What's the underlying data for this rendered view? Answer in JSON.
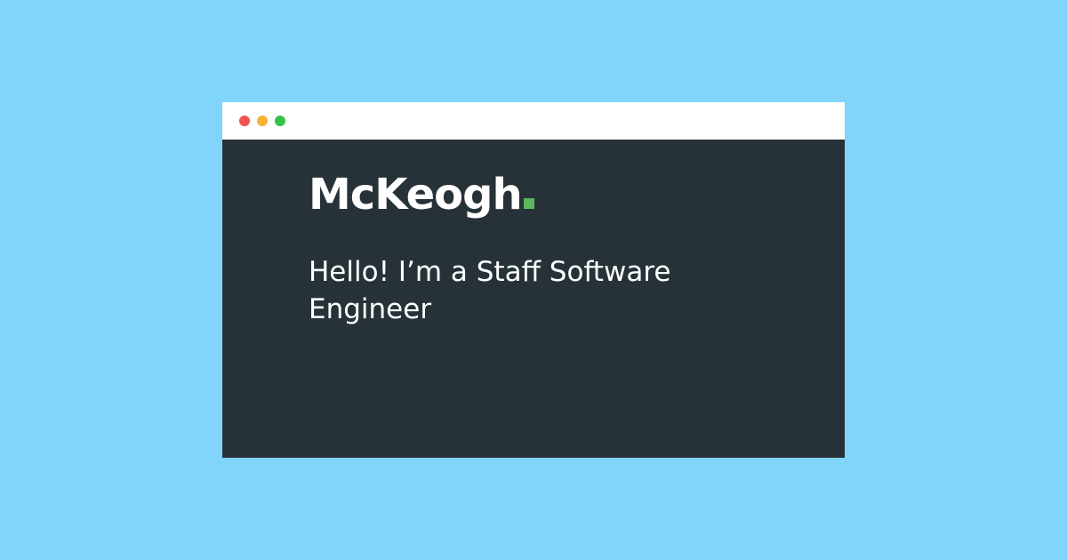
{
  "colors": {
    "background": "#81d4fa",
    "titlebar": "#ffffff",
    "content": "#263238",
    "text": "#ffffff",
    "brand_accent": "#5cb85c",
    "dot_close": "#ef5350",
    "dot_minimize": "#f9b233",
    "dot_maximize": "#34c348"
  },
  "window": {
    "controls": [
      "close-dot",
      "minimize-dot",
      "maximize-dot"
    ]
  },
  "brand": {
    "name": "McKeogh"
  },
  "intro": {
    "text": "Hello! I’m a Staff Software Engineer"
  }
}
